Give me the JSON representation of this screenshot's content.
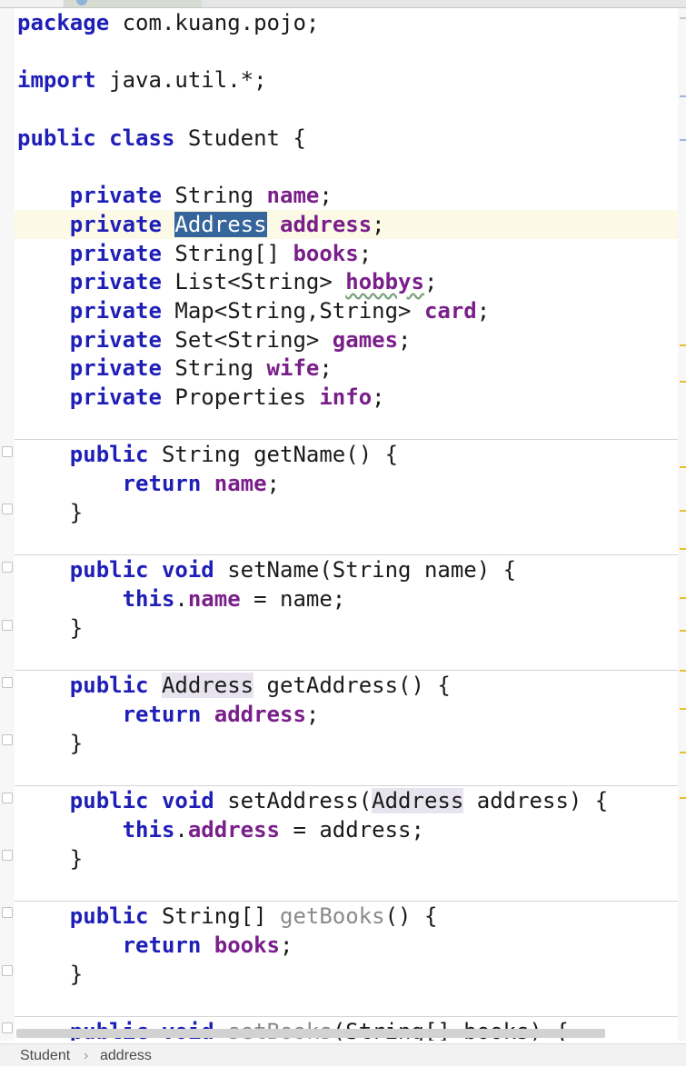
{
  "editor": {
    "colors": {
      "keyword": "#1f1fb8",
      "field": "#7a1f8a",
      "selection": "#35659a",
      "current_line": "#fcfae6"
    },
    "lines": {
      "package_kw": "package",
      "package_name": " com.kuang.pojo;",
      "import_kw": "import",
      "import_name": " java.util.*;",
      "class_kw": "public class",
      "class_rest": " Student {",
      "f1_kw": "private",
      "f1_type": " String ",
      "f1_name": "name",
      "f1_end": ";",
      "f2_kw": "private",
      "f2_type": "Address",
      "f2_name": "address",
      "f2_end": ";",
      "f3_kw": "private",
      "f3_type": " String[] ",
      "f3_name": "books",
      "f3_end": ";",
      "f4_kw": "private",
      "f4_type": " List<String> ",
      "f4_name": "hobbys",
      "f4_end": ";",
      "f5_kw": "private",
      "f5_type": " Map<String,String> ",
      "f5_name": "card",
      "f5_end": ";",
      "f6_kw": "private",
      "f6_type": " Set<String> ",
      "f6_name": "games",
      "f6_end": ";",
      "f7_kw": "private",
      "f7_type": " String ",
      "f7_name": "wife",
      "f7_end": ";",
      "f8_kw": "private",
      "f8_type": " Properties ",
      "f8_name": "info",
      "f8_end": ";",
      "m1_kw": "public",
      "m1_sig": " String getName() {",
      "m1_ret": "return",
      "m1_val": "name",
      "close": "}",
      "m2_kw": "public void",
      "m2_sig": " setName(String name) {",
      "m2_this": "this",
      "m2_fld": "name",
      "m2_rest": " = name;",
      "m3_kw": "public",
      "m3_type": "Address",
      "m3_sig": " getAddress() {",
      "m3_ret": "return",
      "m3_val": "address",
      "m4_kw": "public void",
      "m4_sig_a": " setAddress(",
      "m4_type": "Address",
      "m4_sig_b": " address) {",
      "m4_this": "this",
      "m4_fld": "address",
      "m4_rest": " = address;",
      "m5_kw": "public",
      "m5_type": " String[] ",
      "m5_name": "getBooks",
      "m5_sig": "() {",
      "m5_ret": "return",
      "m5_val": "books",
      "m6_kw": "public void",
      "m6_name": "setBooks",
      "m6_sig": "(String[] books) {"
    }
  },
  "breadcrumb": {
    "class_name": "Student",
    "separator": "›",
    "field_name": "address"
  }
}
